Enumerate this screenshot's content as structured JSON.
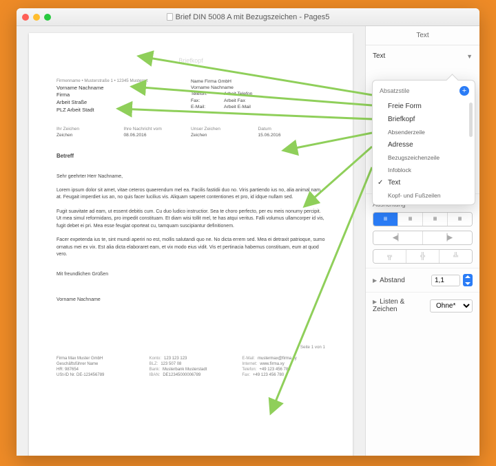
{
  "window": {
    "title": "Brief DIN 5008 A mit Bezugszeichen - Pages5"
  },
  "doc": {
    "briefkopf": "Briefkopf",
    "sender_line": "Firmenname • Musterstraße 1 • 12345 Musterort",
    "addr": {
      "l1": "Vorname Nachname",
      "l2": "Firma",
      "l3": "Arbeit Straße",
      "l4": "PLZ Arbeit Stadt"
    },
    "contact": {
      "company": "Name Firma GmbH",
      "name": "Vorname Nachname",
      "tel_lbl": "Telefon:",
      "tel": "Arbeit Telefon",
      "fax_lbl": "Fax:",
      "fax": "Arbeit Fax",
      "mail_lbl": "E-Mail:",
      "mail": "Arbeit E-Mail"
    },
    "ref": {
      "c1l": "Ihr Zeichen",
      "c1v": "Zeichen",
      "c2l": "Ihre Nachricht vom",
      "c2v": "08.06.2016",
      "c3l": "Unser Zeichen",
      "c3v": "Zeichen",
      "c4l": "Datum",
      "c4v": "15.06.2016"
    },
    "betreff": "Betreff",
    "greet": "Sehr geehrter Herr Nachname,",
    "p1": "Lorem ipsum dolor sit amet, vitae ceteros quaerendum mel ea. Facilis fastidii duo no. Viris partiendo ius no, alia animal nam at. Feugait imperdiet ius an, no quis facer lucilius vis. Aliquam saperet contentiones et pro, id idque nullam sed.",
    "p2": "Fugit suavitate ad eam, ut essent debitis cum. Cu duo ludico instructior. Sea te choro perfecto, per eu meis nonumy percipit. Ut mea simul reformidans, pro impedit constituam. Et diam wisi tollit mel, te has atqui veritus. Falli volumus ullamcorper id vis, fugit debet ei pri. Mea esse feugiat oporteat cu, tamquam suscipiantur definitionem.",
    "p3": "Facer expetenda ius te, sint mundi aperiri no est, mollis salutandi quo ne. No dicta errem sed. Mea ei detraxit patrioque, sumo ornatus mei ex vix. Est alia dicta elaboraret eam, et vix modo eius vidit. Vis et pertinacia habemus constituam, eum at quod vero.",
    "close": "Mit freundlichen Grüßen",
    "sign": "Vorname Nachname",
    "pagenum": "Seite 1 von 1",
    "footer": {
      "a1": "Firma Max Muster GmbH",
      "a2": "Geschäftsführer Name",
      "a3": "HR: 987654",
      "a4": "USt-ID Nr. DE-123456789",
      "b1l": "Konto:",
      "b1v": "123 123 123",
      "b2l": "BLZ:",
      "b2v": "123 507 08",
      "b3l": "Bank:",
      "b3v": "Musterbank Musterstadt",
      "b4l": "IBAN:",
      "b4v": "DE12345000006789",
      "c1l": "E-Mail:",
      "c1v": "mustermax@firma.xy",
      "c2l": "Internet:",
      "c2v": "www.firma.xy",
      "c3l": "Telefon:",
      "c3v": "+49 123 456 789",
      "c4l": "Fax:",
      "c4v": "+49 123 456 780"
    }
  },
  "inspector": {
    "tab": "Text",
    "style_label": "Text",
    "align_label": "Ausrichtung",
    "spacing_label": "Abstand",
    "spacing_value": "1,1",
    "lists_label": "Listen & Zeichen",
    "lists_value": "Ohne*"
  },
  "popover": {
    "title": "Absatzstile",
    "items": [
      {
        "label": "Freie Form",
        "small": false
      },
      {
        "label": "Briefkopf",
        "small": false
      },
      {
        "label": "Absenderzeile",
        "small": true
      },
      {
        "label": "Adresse",
        "small": false
      },
      {
        "label": "Bezugszeichenzeile",
        "small": true
      },
      {
        "label": "Infoblock",
        "small": true
      },
      {
        "label": "Text",
        "small": false,
        "checked": true
      },
      {
        "label": "Kopf- und Fußzeilen",
        "small": true
      }
    ]
  }
}
